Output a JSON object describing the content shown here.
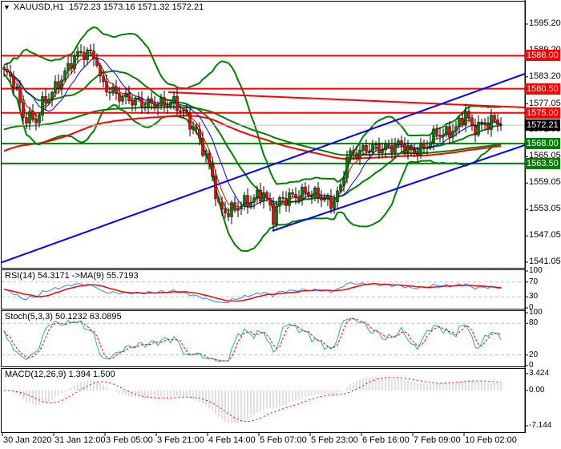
{
  "header": {
    "symbol": "XAUUSD,H1",
    "open": "1572.23",
    "high": "1573.16",
    "low": "1571.32",
    "close": "1572.21"
  },
  "price_axis": {
    "ticks": [
      "1595.20",
      "1589.20",
      "1583.20",
      "1577.05",
      "1571.05",
      "1565.05",
      "1559.05",
      "1553.05",
      "1547.05",
      "1541.05"
    ]
  },
  "levels": [
    {
      "label": "1588.00",
      "price": 1588.0,
      "color": "#ff0000"
    },
    {
      "label": "1580.50",
      "price": 1580.5,
      "color": "#ff0000"
    },
    {
      "label": "1575.00",
      "price": 1575.0,
      "color": "#ff0000"
    },
    {
      "label": "1568.00",
      "price": 1568.0,
      "color": "#008000"
    },
    {
      "label": "1563.50",
      "price": 1563.5,
      "color": "#008000"
    }
  ],
  "current_price": {
    "label": "1572.21",
    "price": 1572.21,
    "color": "#000000"
  },
  "rsi": {
    "title": "RSI(14) 54.3171  ->MA(9) 55.7193",
    "ticks": [
      "100",
      "70",
      "30",
      "0"
    ]
  },
  "stoch": {
    "title": "Stoch(5,3,3) 50.1232 63.0895",
    "ticks": [
      "100",
      "80",
      "20",
      "0"
    ]
  },
  "macd": {
    "title": "MACD(12,26,9) 1.394 1.500",
    "ticks": [
      "3.424",
      "0.00",
      "-7.144"
    ]
  },
  "time_axis": [
    "30 Jan 2020",
    "31 Jan 12:00",
    "3 Feb 05:00",
    "3 Feb 21:00",
    "4 Feb 14:00",
    "5 Feb 07:00",
    "5 Feb 23:00",
    "6 Feb 16:00",
    "7 Feb 09:00",
    "10 Feb 02:00"
  ],
  "colors": {
    "bull": "#008000",
    "bear": "#ff0000",
    "trend": "#0000ff",
    "band": "#008000",
    "rsi": "#1e90ff",
    "stoch": "#20b2aa",
    "signal": "#ff0000",
    "hist": "#c0c0c0"
  },
  "chart_data": {
    "type": "candlestick",
    "symbol": "XAUUSD",
    "timeframe": "H1",
    "ylim": [
      1541.05,
      1595.2
    ],
    "bar_count": 156,
    "close_keypoints": [
      [
        0,
        1584.3
      ],
      [
        3,
        1582.4
      ],
      [
        6,
        1574.2
      ],
      [
        10,
        1573.3
      ],
      [
        12,
        1577
      ],
      [
        16,
        1580.6
      ],
      [
        20,
        1585.2
      ],
      [
        22,
        1587.9
      ],
      [
        26,
        1588.8
      ],
      [
        29,
        1587
      ],
      [
        30,
        1582.4
      ],
      [
        32,
        1580.6
      ],
      [
        36,
        1578.8
      ],
      [
        40,
        1577.9
      ],
      [
        44,
        1577
      ],
      [
        49,
        1577
      ],
      [
        53,
        1577.4
      ],
      [
        56,
        1575.1
      ],
      [
        60,
        1570.6
      ],
      [
        62,
        1567
      ],
      [
        65,
        1560.6
      ],
      [
        67,
        1553.3
      ],
      [
        70,
        1552.4
      ],
      [
        74,
        1554.2
      ],
      [
        77,
        1555.1
      ],
      [
        81,
        1556.9
      ],
      [
        84,
        1551.4
      ],
      [
        86,
        1555.1
      ],
      [
        90,
        1556
      ],
      [
        94,
        1556.9
      ],
      [
        99,
        1556
      ],
      [
        102,
        1554.2
      ],
      [
        105,
        1557.8
      ],
      [
        107,
        1565.1
      ],
      [
        110,
        1566
      ],
      [
        114,
        1567
      ],
      [
        119,
        1567
      ],
      [
        124,
        1567.9
      ],
      [
        127,
        1566
      ],
      [
        131,
        1567
      ],
      [
        135,
        1570.6
      ],
      [
        137,
        1570
      ],
      [
        141,
        1571.5
      ],
      [
        144,
        1575.1
      ],
      [
        146,
        1571.5
      ],
      [
        150,
        1572.5
      ],
      [
        153,
        1573.3
      ],
      [
        155,
        1572.21
      ]
    ]
  }
}
